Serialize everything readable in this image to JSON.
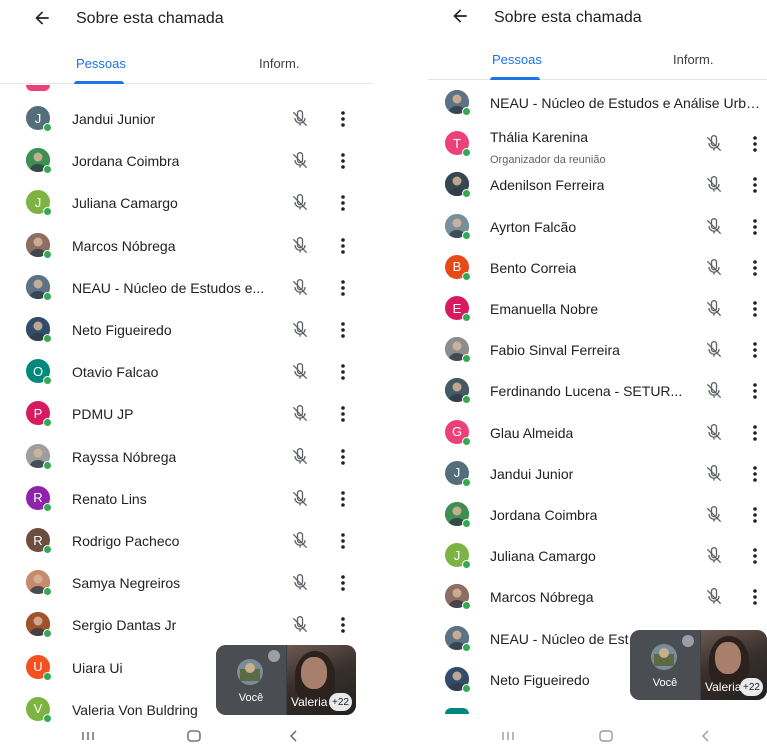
{
  "left": {
    "header": {
      "title": "Sobre esta chamada"
    },
    "tabs": [
      {
        "label": "Pessoas"
      },
      {
        "label": "Inform."
      }
    ],
    "people": [
      {
        "name": "Jandui Junior",
        "initial": "J",
        "color": "#546e7a",
        "photo": false,
        "muted": true
      },
      {
        "name": "Jordana Coimbra",
        "initial": "",
        "color": "#3f8f52",
        "photo": true,
        "muted": true
      },
      {
        "name": "Juliana Camargo",
        "initial": "J",
        "color": "#7cb342",
        "photo": false,
        "muted": true
      },
      {
        "name": "Marcos Nóbrega",
        "initial": "",
        "color": "#8d6e63",
        "photo": true,
        "muted": true
      },
      {
        "name": "NEAU - Núcleo de Estudos e...",
        "initial": "",
        "color": "#5d7285",
        "photo": true,
        "muted": true
      },
      {
        "name": "Neto Figueiredo",
        "initial": "",
        "color": "#324d6b",
        "photo": true,
        "muted": true
      },
      {
        "name": "Otavio Falcao",
        "initial": "O",
        "color": "#00897b",
        "photo": false,
        "muted": true
      },
      {
        "name": "PDMU JP",
        "initial": "P",
        "color": "#d81b60",
        "photo": false,
        "muted": true
      },
      {
        "name": "Rayssa Nóbrega",
        "initial": "",
        "color": "#9e9e9e",
        "photo": true,
        "muted": true
      },
      {
        "name": "Renato Lins",
        "initial": "R",
        "color": "#8e24aa",
        "photo": false,
        "muted": true
      },
      {
        "name": "Rodrigo Pacheco",
        "initial": "R",
        "color": "#6d4c41",
        "photo": false,
        "muted": true
      },
      {
        "name": "Samya Negreiros",
        "initial": "",
        "color": "#c58b6d",
        "photo": true,
        "muted": true
      },
      {
        "name": "Sergio Dantas Jr",
        "initial": "",
        "color": "#a0522d",
        "photo": true,
        "muted": true
      },
      {
        "name": "Uiara Ui",
        "initial": "U",
        "color": "#f4511e",
        "photo": false,
        "muted": false
      },
      {
        "name": "Valeria Von Buldring",
        "initial": "V",
        "color": "#7cb342",
        "photo": false,
        "muted": false
      }
    ],
    "pip": {
      "self_label": "Você",
      "video_name": "Valeria",
      "count": "+22"
    }
  },
  "right": {
    "header": {
      "title": "Sobre esta chamada"
    },
    "tabs": [
      {
        "label": "Pessoas"
      },
      {
        "label": "Inform."
      }
    ],
    "people": [
      {
        "name": "NEAU - Núcleo de Estudos e Análise Urba...",
        "initial": "",
        "color": "#5d7285",
        "photo": true,
        "muted": false,
        "controls": false
      },
      {
        "name": "Thália Karenina",
        "subtitle": "Organizador da reunião",
        "initial": "T",
        "color": "#ec407a",
        "photo": false,
        "muted": true,
        "controls": true
      },
      {
        "name": "Adenilson Ferreira",
        "initial": "",
        "color": "#37474f",
        "photo": true,
        "muted": true,
        "controls": true
      },
      {
        "name": "Ayrton Falcão",
        "initial": "",
        "color": "#78909c",
        "photo": true,
        "muted": true,
        "controls": true
      },
      {
        "name": "Bento Correia",
        "initial": "B",
        "color": "#e64a19",
        "photo": false,
        "muted": true,
        "controls": true
      },
      {
        "name": "Emanuella Nobre",
        "initial": "E",
        "color": "#d81b60",
        "photo": false,
        "muted": true,
        "controls": true
      },
      {
        "name": "Fabio Sinval Ferreira",
        "initial": "",
        "color": "#8d8d8d",
        "photo": true,
        "muted": true,
        "controls": true
      },
      {
        "name": "Ferdinando Lucena - SETUR...",
        "initial": "",
        "color": "#455a64",
        "photo": true,
        "muted": true,
        "controls": true
      },
      {
        "name": "Glau Almeida",
        "initial": "G",
        "color": "#ec407a",
        "photo": false,
        "muted": true,
        "controls": true
      },
      {
        "name": "Jandui Junior",
        "initial": "J",
        "color": "#546e7a",
        "photo": false,
        "muted": true,
        "controls": true
      },
      {
        "name": "Jordana Coimbra",
        "initial": "",
        "color": "#3f8f52",
        "photo": true,
        "muted": true,
        "controls": true
      },
      {
        "name": "Juliana Camargo",
        "initial": "J",
        "color": "#7cb342",
        "photo": false,
        "muted": true,
        "controls": true
      },
      {
        "name": "Marcos Nóbrega",
        "initial": "",
        "color": "#8d6e63",
        "photo": true,
        "muted": true,
        "controls": true
      },
      {
        "name": "NEAU - Núcleo de Est",
        "initial": "",
        "color": "#5d7285",
        "photo": true,
        "muted": false,
        "controls": false
      },
      {
        "name": "Neto Figueiredo",
        "initial": "",
        "color": "#324d6b",
        "photo": true,
        "muted": false,
        "controls": false
      }
    ],
    "pip": {
      "self_label": "Você",
      "video_name": "Valeria",
      "count": "+22"
    }
  },
  "icons": {
    "back": "arrow-left-icon",
    "mic": "mic-off-icon",
    "more": "more-vert-icon",
    "nav_recents": "recents-icon",
    "nav_home": "home-icon",
    "nav_back": "back-chevron-icon"
  },
  "colors": {
    "accent": "#1a73e8",
    "presence": "#34a853",
    "icon": "#5f6368"
  }
}
